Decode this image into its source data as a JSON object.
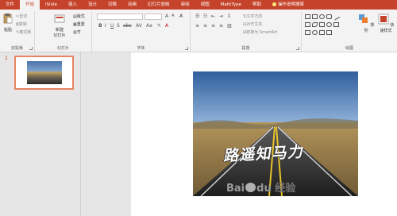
{
  "tabs": [
    {
      "label": "文件"
    },
    {
      "label": "开始",
      "active": true
    },
    {
      "label": "iSlide"
    },
    {
      "label": "插入"
    },
    {
      "label": "设计"
    },
    {
      "label": "切换"
    },
    {
      "label": "动画"
    },
    {
      "label": "幻灯片放映"
    },
    {
      "label": "审阅"
    },
    {
      "label": "视图"
    },
    {
      "label": "MathType"
    },
    {
      "label": "帮助"
    },
    {
      "label": "操作说明搜索"
    }
  ],
  "ribbon": {
    "clipboard": {
      "paste": "粘贴",
      "cut": "剪切",
      "copy": "复制",
      "format_painter": "格式刷",
      "label": "剪贴板"
    },
    "slides": {
      "new_slide_line1": "新建",
      "new_slide_line2": "幻灯片",
      "layout": "版式",
      "reset": "重置",
      "section": "节",
      "label": "幻灯片"
    },
    "font": {
      "label": "字体"
    },
    "paragraph": {
      "text_direction": "文字方向",
      "align_text": "对齐文本",
      "smartart": "转换为 SmartArt",
      "label": "段落"
    },
    "drawing": {
      "arrange": "排列",
      "quick_styles": "快速样式",
      "label": "绘图"
    }
  },
  "thumbnails": [
    {
      "number": "1"
    }
  ],
  "slide": {
    "overlay_text": "路遥知马力"
  },
  "watermark": {
    "brand_a": "Bai",
    "brand_b": "du",
    "suffix": "经验"
  },
  "colors": {
    "accent": "#c5432a"
  }
}
